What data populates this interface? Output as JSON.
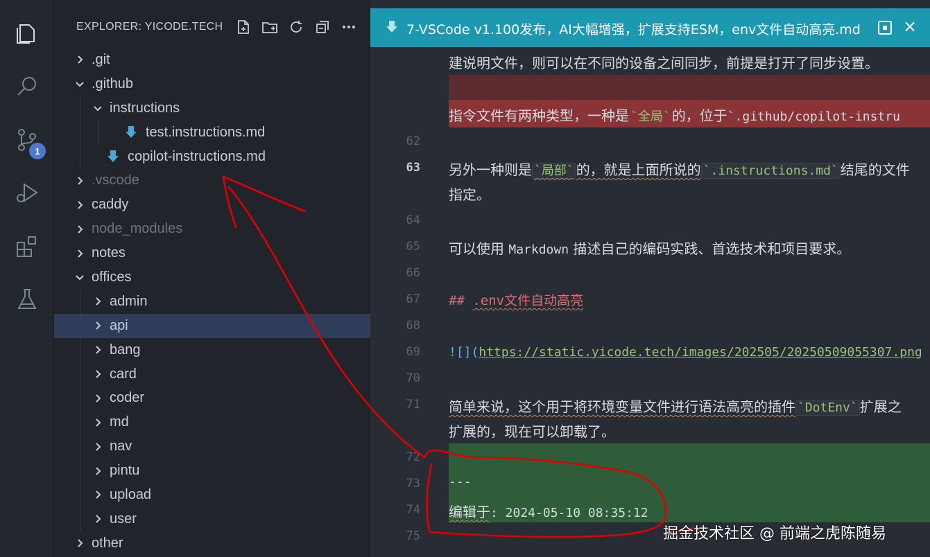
{
  "activity_bar": {
    "items": [
      {
        "name": "explorer-icon",
        "active": true
      },
      {
        "name": "search-icon"
      },
      {
        "name": "source-control-icon",
        "badge": "1"
      },
      {
        "name": "run-debug-icon"
      },
      {
        "name": "extensions-icon"
      },
      {
        "name": "testing-icon"
      }
    ]
  },
  "sidebar": {
    "title": "EXPLORER: YICODE.TECH",
    "actions": [
      "new-file-icon",
      "new-folder-icon",
      "refresh-icon",
      "collapse-all-icon",
      "more-icon"
    ],
    "tree": [
      {
        "label": ".git",
        "type": "folder",
        "expanded": false,
        "depth": 0
      },
      {
        "label": ".github",
        "type": "folder",
        "expanded": true,
        "depth": 0
      },
      {
        "label": "instructions",
        "type": "folder",
        "expanded": true,
        "depth": 1
      },
      {
        "label": "test.instructions.md",
        "type": "file",
        "depth": 2
      },
      {
        "label": "copilot-instructions.md",
        "type": "file",
        "depth": 1
      },
      {
        "label": ".vscode",
        "type": "folder",
        "expanded": false,
        "depth": 0,
        "dim": true
      },
      {
        "label": "caddy",
        "type": "folder",
        "expanded": false,
        "depth": 0
      },
      {
        "label": "node_modules",
        "type": "folder",
        "expanded": false,
        "depth": 0,
        "dim": true
      },
      {
        "label": "notes",
        "type": "folder",
        "expanded": false,
        "depth": 0
      },
      {
        "label": "offices",
        "type": "folder",
        "expanded": true,
        "depth": 0
      },
      {
        "label": "admin",
        "type": "folder",
        "expanded": false,
        "depth": 1
      },
      {
        "label": "api",
        "type": "folder",
        "expanded": false,
        "depth": 1,
        "selected": true
      },
      {
        "label": "bang",
        "type": "folder",
        "expanded": false,
        "depth": 1
      },
      {
        "label": "card",
        "type": "folder",
        "expanded": false,
        "depth": 1
      },
      {
        "label": "coder",
        "type": "folder",
        "expanded": false,
        "depth": 1
      },
      {
        "label": "md",
        "type": "folder",
        "expanded": false,
        "depth": 1
      },
      {
        "label": "nav",
        "type": "folder",
        "expanded": false,
        "depth": 1
      },
      {
        "label": "pintu",
        "type": "folder",
        "expanded": false,
        "depth": 1
      },
      {
        "label": "upload",
        "type": "folder",
        "expanded": false,
        "depth": 1
      },
      {
        "label": "user",
        "type": "folder",
        "expanded": false,
        "depth": 1
      },
      {
        "label": "other",
        "type": "folder",
        "expanded": false,
        "depth": 0
      }
    ]
  },
  "editor": {
    "tab": {
      "label": "7-VSCode v1.100发布，AI大幅增强，扩展支持ESM，env文件自动高亮.md",
      "preview_icon": "open-preview-icon",
      "close_icon": "×"
    },
    "lines": {
      "l60_text": "建说明文件，则可以在不同的设备之间同步，前提是打开了同步设置。",
      "l61a_text": "指令文件有两种类型，一种是",
      "l61a_code": "`全局`",
      "l61a_mid": "的，位于",
      "l61a_code2": "`.github/copilot-instru",
      "n62": "62",
      "n63": "63",
      "l63_a": "另外一种则是",
      "l63_code": "`局部`",
      "l63_b": "的，就是上面所说的",
      "l63_code2": "`.instructions.md`",
      "l63_c": "结尾的文件",
      "l63_wrap": "指定。",
      "n64": "64",
      "n65": "65",
      "l65_a": "可以使用 ",
      "l65_mono": "Markdown",
      "l65_b": " 描述自己的编码实践、首选技术和项目要求。",
      "n66": "66",
      "n67": "67",
      "l67_hash": "## ",
      "l67_text": ".env文件自动高亮",
      "n68": "68",
      "n69": "69",
      "l69_bracket": "![](",
      "l69_url": "https://static.yicode.tech/images/202505/20250509055307.png",
      "n70": "70",
      "n71": "71",
      "l71_a": "简单来说，这个用于将环境变量文件进行语法高亮的插件",
      "l71_code": "`DotEnv`",
      "l71_b": "扩展之",
      "l71_wrap": "扩展的，现在可以卸载了。",
      "n72": "72",
      "n73": "73",
      "l73_text": "---",
      "n74": "74",
      "l74_a": "编辑于",
      "l74_b": ": 2024-05-10 08:35:12",
      "n75": "75"
    }
  },
  "watermark": "掘金技术社区 @ 前端之虎陈随易",
  "colors": {
    "accent": "#1c98b1",
    "annotation": "#e00000",
    "badge": "#4d78cc"
  }
}
